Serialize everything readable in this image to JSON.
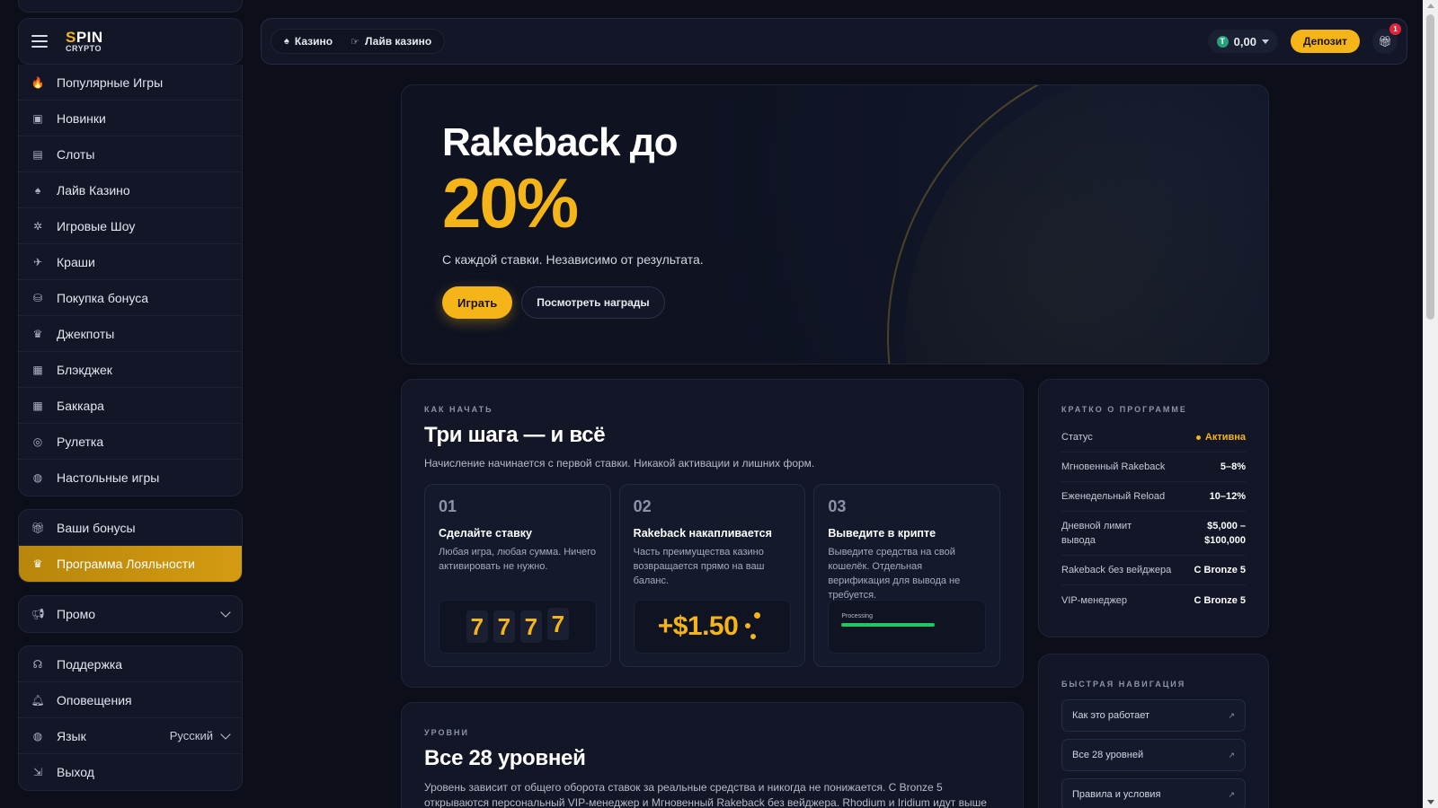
{
  "brand": {
    "name_a": "S",
    "name_b": "PIN",
    "name_sub": "CRYPTO"
  },
  "sidebar": {
    "games": [
      {
        "label": "Популярные Игры",
        "icon": "fire-icon",
        "glyph": "🔥"
      },
      {
        "label": "Новинки",
        "icon": "new-icon",
        "glyph": "▣"
      },
      {
        "label": "Слоты",
        "icon": "slots-icon",
        "glyph": "▤"
      },
      {
        "label": "Лайв Казино",
        "icon": "live-casino-icon",
        "glyph": "♠"
      },
      {
        "label": "Игровые Шоу",
        "icon": "game-show-icon",
        "glyph": "✲"
      },
      {
        "label": "Краши",
        "icon": "plane-icon",
        "glyph": "✈"
      },
      {
        "label": "Покупка бонуса",
        "icon": "bonus-buy-icon",
        "glyph": "⛁"
      },
      {
        "label": "Джекпоты",
        "icon": "jackpot-icon",
        "glyph": "♛"
      },
      {
        "label": "Блэкджек",
        "icon": "blackjack-icon",
        "glyph": "▦"
      },
      {
        "label": "Баккара",
        "icon": "baccarat-icon",
        "glyph": "▦"
      },
      {
        "label": "Рулетка",
        "icon": "roulette-icon",
        "glyph": "◎"
      },
      {
        "label": "Настольные игры",
        "icon": "table-games-icon",
        "glyph": "◍"
      }
    ],
    "bonuses_label": "Ваши бонусы",
    "loyalty_label": "Программа Лояльности",
    "promo_label": "Промо",
    "support_label": "Поддержка",
    "notifications_label": "Оповещения",
    "language_label": "Язык",
    "language_value": "Русский",
    "logout_label": "Выход"
  },
  "topbar": {
    "tab_casino": "Казино",
    "tab_live": "Лайв казино",
    "balance": "0,00",
    "coin_symbol": "T",
    "deposit": "Депозит",
    "gift_badge": "1"
  },
  "hero": {
    "title": "Rakeback до",
    "percent": "20%",
    "subtitle": "С каждой ставки. Независимо от результата.",
    "play": "Играть",
    "rewards": "Посмотреть награды"
  },
  "how": {
    "eyebrow": "КАК НАЧАТЬ",
    "title": "Три шага — и всё",
    "desc": "Начисление начинается с первой ставки. Никакой активации и лишних форм.",
    "steps": [
      {
        "num": "01",
        "title": "Сделайте ставку",
        "desc": "Любая игра, любая сумма. Ничего активировать не нужно."
      },
      {
        "num": "02",
        "title": "Rakeback накапливается",
        "desc": "Часть преимущества казино возвращается прямо на ваш баланс."
      },
      {
        "num": "03",
        "title": "Выведите в крипте",
        "desc": "Выведите средства на свой кошелёк. Отдельная верификация для вывода не требуется."
      }
    ],
    "slot_digits": [
      "7",
      "7",
      "7",
      "7"
    ],
    "amount": "+$1.50",
    "processing": "Processing",
    "processing_progress": 0.65
  },
  "levels": {
    "eyebrow": "УРОВНИ",
    "title": "Все 28 уровней",
    "desc": "Уровень зависит от общего оборота ставок за реальные средства и никогда не понижается. С Bronze 5 открываются персональный VIP-менеджер и Мгновенный Rakeback без вейджера. Rhodium и Iridium идут выше Diamond и дают"
  },
  "summary": {
    "eyebrow": "КРАТКО О ПРОГРАММЕ",
    "rows": [
      {
        "k": "Статус",
        "v": "Активна"
      },
      {
        "k": "Мгновенный Rakeback",
        "v": "5–8%"
      },
      {
        "k": "Еженедельный Reload",
        "v": "10–12%"
      },
      {
        "k": "Дневной лимит вывода",
        "v": "$5,000 – $100,000"
      },
      {
        "k": "Rakeback без вейджера",
        "v": "С Bronze 5"
      },
      {
        "k": "VIP-менеджер",
        "v": "С Bronze 5"
      }
    ]
  },
  "quicknav": {
    "eyebrow": "БЫСТРАЯ НАВИГАЦИЯ",
    "links": [
      "Как это работает",
      "Все 28 уровней",
      "Правила и условия"
    ]
  },
  "colors": {
    "accent": "#f5b417",
    "bg": "#0c0f1a",
    "card": "#121627",
    "success": "#22c55e"
  }
}
